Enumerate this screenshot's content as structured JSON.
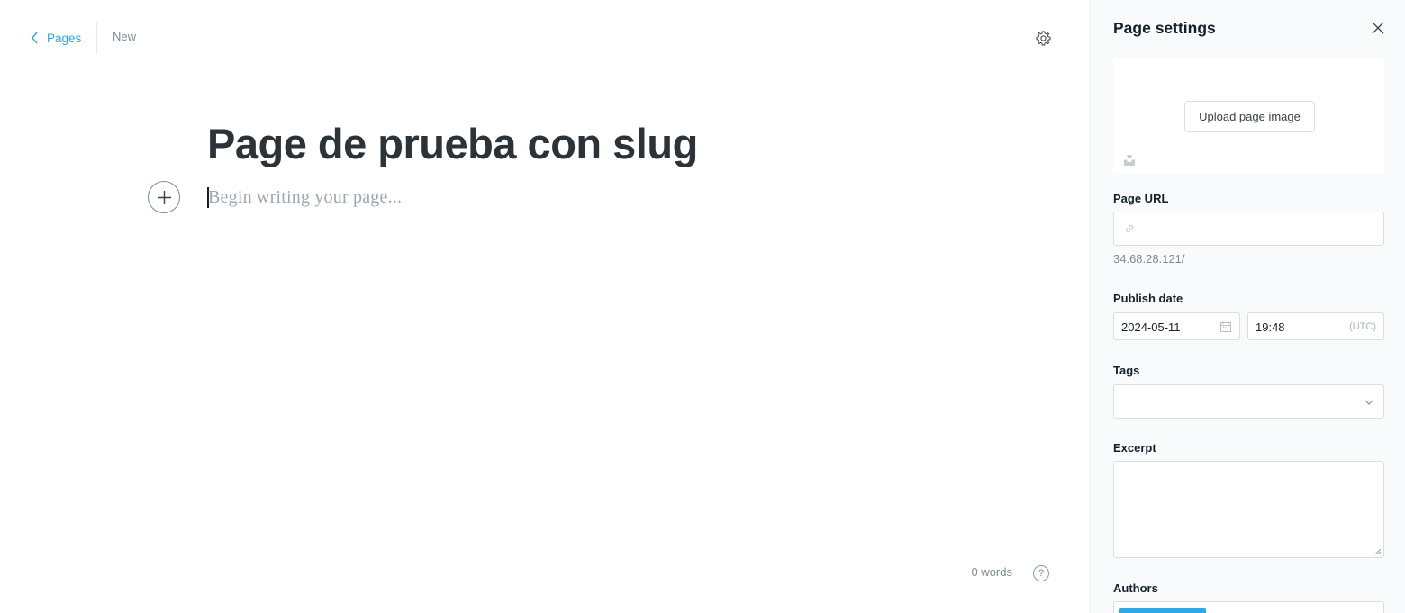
{
  "header": {
    "back_label": "Pages",
    "status": "New"
  },
  "editor": {
    "title": "Page de prueba con slug",
    "body_placeholder": "Begin writing your page...",
    "word_count": "0 words",
    "help_label": "?"
  },
  "sidebar": {
    "title": "Page settings",
    "image": {
      "upload_label": "Upload page image"
    },
    "url": {
      "label": "Page URL",
      "value": "",
      "hint": "34.68.28.121/"
    },
    "publish": {
      "label": "Publish date",
      "date": "2024-05-11",
      "time": "19:48",
      "timezone": "(UTC)"
    },
    "tags": {
      "label": "Tags",
      "value": ""
    },
    "excerpt": {
      "label": "Excerpt",
      "value": ""
    },
    "authors": {
      "label": "Authors"
    }
  },
  "icons": {
    "back": "chevron-left-icon",
    "settings": "gear-icon",
    "add": "plus-icon",
    "close": "close-icon",
    "unsplash": "unsplash-icon",
    "link": "link-icon",
    "calendar": "calendar-icon",
    "dropdown": "chevron-down-icon"
  },
  "colors": {
    "accent": "#30a6d9",
    "author_chip": "#2fa8e6",
    "sidebar_bg": "#f9fafb",
    "title_text": "#2b3339"
  }
}
